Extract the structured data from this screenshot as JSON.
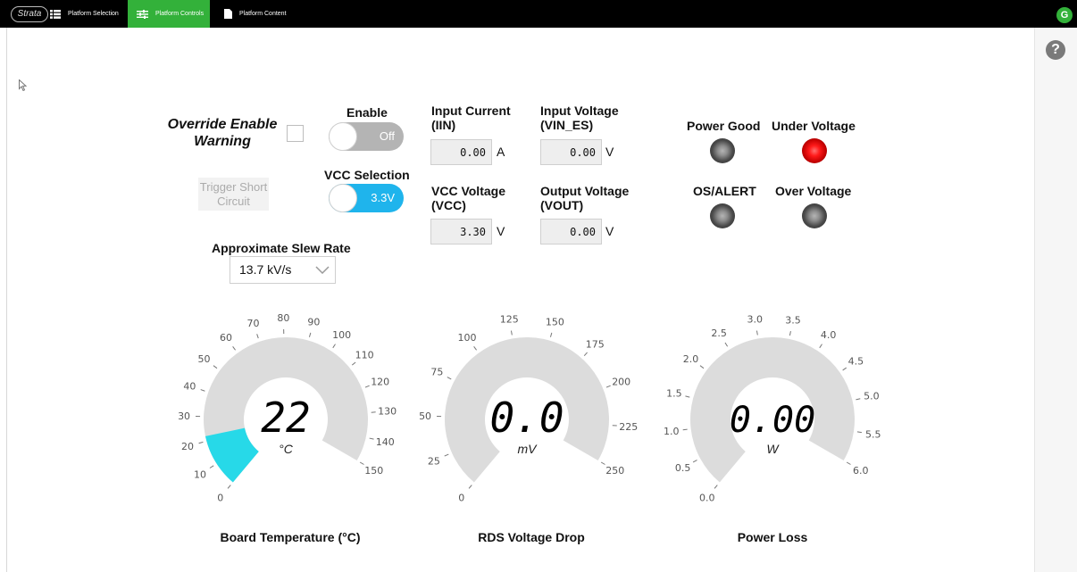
{
  "topbar": {
    "logo": "Strata",
    "tabs": [
      {
        "label": "Platform Selection"
      },
      {
        "label": "Platform Controls"
      },
      {
        "label": "Platform Content"
      }
    ],
    "avatar": "G"
  },
  "help_label": "?",
  "colors": {
    "accent": "#33b13a",
    "toggle_on": "#1fb4ec",
    "gauge_fill": "#27d9e8",
    "led_red": "#ff1a1a"
  },
  "controls": {
    "override_label": "Override Enable Warning",
    "override_checked": false,
    "enable_label": "Enable",
    "enable_state": "Off",
    "vcc_label": "VCC Selection",
    "vcc_state": "3.3V",
    "trigger_label": "Trigger Short Circuit",
    "slew_label": "Approximate Slew Rate",
    "slew_value": "13.7 kV/s"
  },
  "readouts": {
    "iin": {
      "title": "Input Current (IIN)",
      "value": "0.00",
      "unit": "A"
    },
    "vin": {
      "title": "Input Voltage (VIN_ES)",
      "value": "0.00",
      "unit": "V"
    },
    "vcc": {
      "title": "VCC Voltage (VCC)",
      "value": "3.30",
      "unit": "V"
    },
    "vout": {
      "title": "Output Voltage (VOUT)",
      "value": "0.00",
      "unit": "V"
    }
  },
  "indicators": [
    {
      "label": "Power Good",
      "on": false
    },
    {
      "label": "Under Voltage",
      "on": true
    },
    {
      "label": "OS/ALERT",
      "on": false
    },
    {
      "label": "Over Voltage",
      "on": false
    }
  ],
  "gauges": [
    {
      "name": "temp",
      "title": "Board Temperature (°C)",
      "display": "22",
      "unit": "°C",
      "min": 0,
      "max": 150,
      "value": 22,
      "ticks": [
        "0",
        "10",
        "20",
        "30",
        "40",
        "50",
        "60",
        "70",
        "80",
        "90",
        "100",
        "110",
        "120",
        "130",
        "140",
        "150"
      ]
    },
    {
      "name": "rds",
      "title": "RDS Voltage Drop",
      "display": "0.0",
      "unit": "mV",
      "min": 0,
      "max": 250,
      "value": 0,
      "ticks": [
        "0",
        "25",
        "50",
        "75",
        "100",
        "125",
        "150",
        "175",
        "200",
        "225",
        "250"
      ]
    },
    {
      "name": "power",
      "title": "Power Loss",
      "display": "0.00",
      "unit": "W",
      "min": 0,
      "max": 6,
      "value": 0,
      "ticks": [
        "0.0",
        "0.5",
        "1.0",
        "1.5",
        "2.0",
        "2.5",
        "3.0",
        "3.5",
        "4.0",
        "4.5",
        "5.0",
        "5.5",
        "6.0"
      ]
    }
  ]
}
